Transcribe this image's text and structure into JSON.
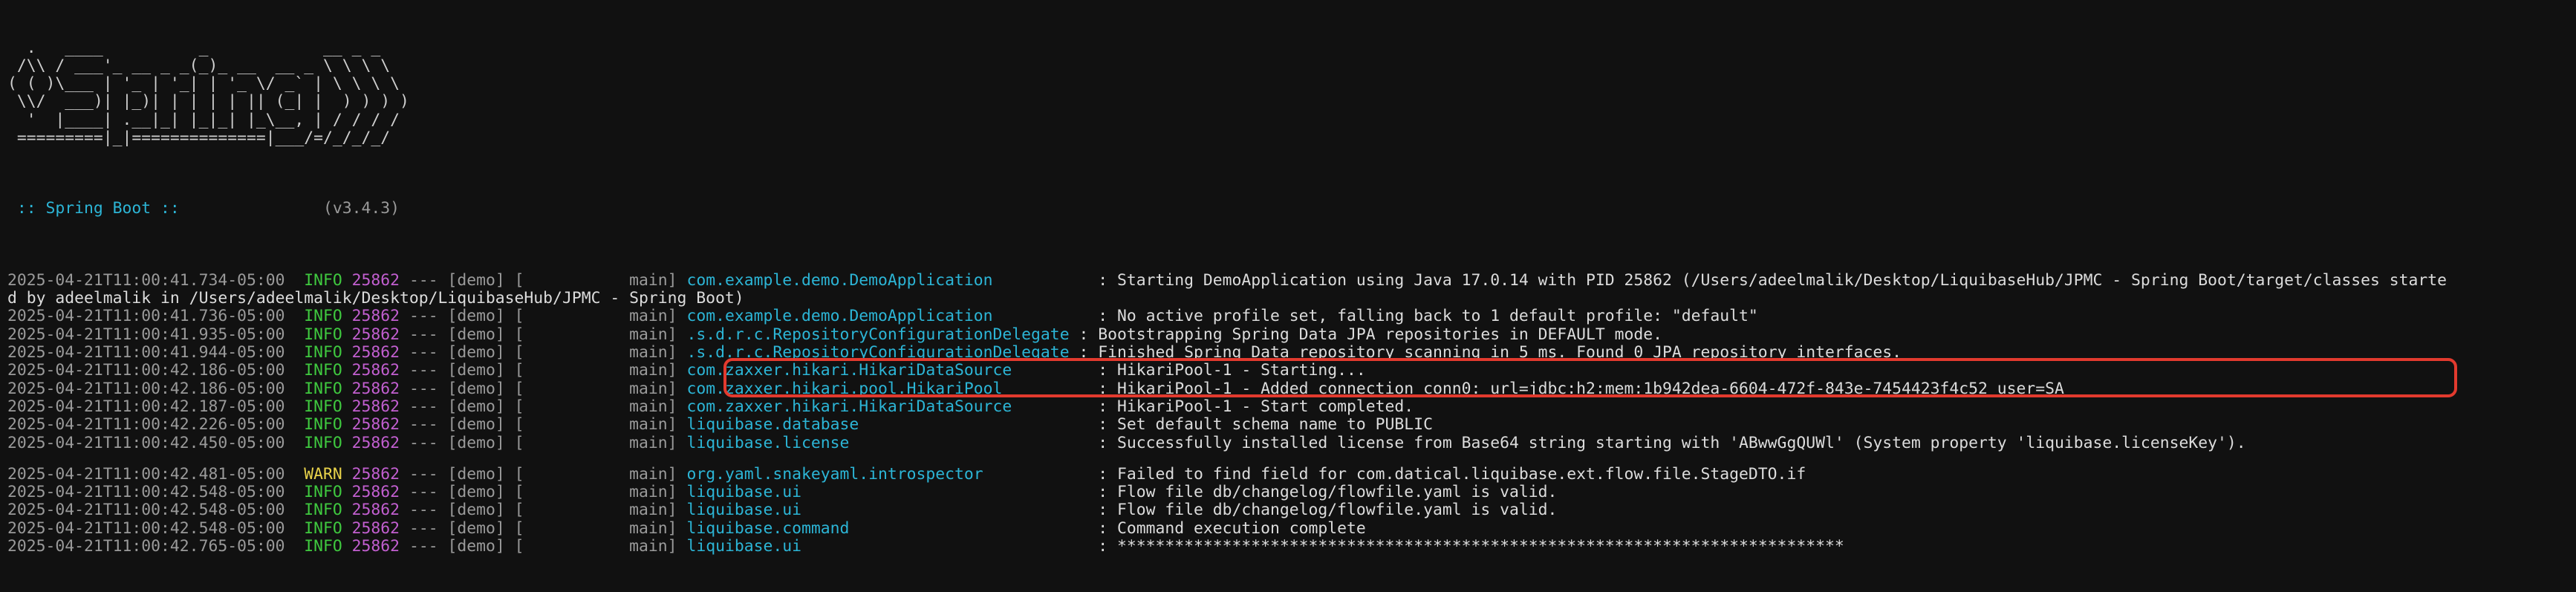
{
  "banner": [
    "  .   ____          _            __ _ _",
    " /\\\\ / ___'_ __ _ _(_)_ __  __ _ \\ \\ \\ \\",
    "( ( )\\___ | '_ | '_| | '_ \\/ _` | \\ \\ \\ \\",
    " \\\\/  ___)| |_)| | | | | || (_| |  ) ) ) )",
    "  '  |____| .__|_| |_|_| |_\\__, | / / / /",
    " =========|_|==============|___/=/_/_/_/"
  ],
  "boot": {
    "name": " :: Spring Boot :: ",
    "version": "              (v3.4.3)"
  },
  "logs": [
    {
      "ts": "2025-04-21T11:00:41.734-05:00",
      "level": "INFO",
      "pid": "25862",
      "sep": " --- ",
      "app": "[demo] [",
      "thread": "           main] ",
      "logger": "com.example.demo.DemoApplication          ",
      "msg": " : Starting DemoApplication using Java 17.0.14 with PID 25862 (/Users/adeelmalik/Desktop/LiquibaseHub/JPMC - Spring Boot/target/classes starte"
    },
    {
      "wrap": "d by adeelmalik in /Users/adeelmalik/Desktop/LiquibaseHub/JPMC - Spring Boot)"
    },
    {
      "ts": "2025-04-21T11:00:41.736-05:00",
      "level": "INFO",
      "pid": "25862",
      "sep": " --- ",
      "app": "[demo] [",
      "thread": "           main] ",
      "logger": "com.example.demo.DemoApplication          ",
      "msg": " : No active profile set, falling back to 1 default profile: \"default\""
    },
    {
      "ts": "2025-04-21T11:00:41.935-05:00",
      "level": "INFO",
      "pid": "25862",
      "sep": " --- ",
      "app": "[demo] [",
      "thread": "           main] ",
      "logger": ".s.d.r.c.RepositoryConfigurationDelegate",
      "msg": " : Bootstrapping Spring Data JPA repositories in DEFAULT mode."
    },
    {
      "ts": "2025-04-21T11:00:41.944-05:00",
      "level": "INFO",
      "pid": "25862",
      "sep": " --- ",
      "app": "[demo] [",
      "thread": "           main] ",
      "logger": ".s.d.r.c.RepositoryConfigurationDelegate",
      "msg": " : Finished Spring Data repository scanning in 5 ms. Found 0 JPA repository interfaces."
    },
    {
      "ts": "2025-04-21T11:00:42.186-05:00",
      "level": "INFO",
      "pid": "25862",
      "sep": " --- ",
      "app": "[demo] [",
      "thread": "           main] ",
      "logger": "com.zaxxer.hikari.HikariDataSource        ",
      "msg": " : HikariPool-1 - Starting..."
    },
    {
      "ts": "2025-04-21T11:00:42.186-05:00",
      "level": "INFO",
      "pid": "25862",
      "sep": " --- ",
      "app": "[demo] [",
      "thread": "           main] ",
      "logger": "com.zaxxer.hikari.pool.HikariPool         ",
      "msg": " : HikariPool-1 - Added connection conn0: url=jdbc:h2:mem:1b942dea-6604-472f-843e-7454423f4c52 user=SA"
    },
    {
      "ts": "2025-04-21T11:00:42.187-05:00",
      "level": "INFO",
      "pid": "25862",
      "sep": " --- ",
      "app": "[demo] [",
      "thread": "           main] ",
      "logger": "com.zaxxer.hikari.HikariDataSource        ",
      "msg": " : HikariPool-1 - Start completed."
    },
    {
      "ts": "2025-04-21T11:00:42.226-05:00",
      "level": "INFO",
      "pid": "25862",
      "sep": " --- ",
      "app": "[demo] [",
      "thread": "           main] ",
      "logger": "liquibase.database                        ",
      "msg": " : Set default schema name to PUBLIC"
    },
    {
      "ts": "2025-04-21T11:00:42.450-05:00",
      "level": "INFO",
      "pid": "25862",
      "sep": " --- ",
      "app": "[demo] [",
      "thread": "           main] ",
      "logger": "liquibase.license                         ",
      "msg": " : Successfully installed license from Base64 string starting with 'ABwwGgQUWl' (System property 'liquibase.licenseKey')."
    },
    {
      "gap": true
    },
    {
      "ts": "2025-04-21T11:00:42.481-05:00",
      "level": "WARN",
      "pid": "25862",
      "sep": " --- ",
      "app": "[demo] [",
      "thread": "           main] ",
      "logger": "org.yaml.snakeyaml.introspector           ",
      "msg": " : Failed to find field for com.datical.liquibase.ext.flow.file.StageDTO.if"
    },
    {
      "ts": "2025-04-21T11:00:42.548-05:00",
      "level": "INFO",
      "pid": "25862",
      "sep": " --- ",
      "app": "[demo] [",
      "thread": "           main] ",
      "logger": "liquibase.ui                              ",
      "msg": " : Flow file db/changelog/flowfile.yaml is valid."
    },
    {
      "ts": "2025-04-21T11:00:42.548-05:00",
      "level": "INFO",
      "pid": "25862",
      "sep": " --- ",
      "app": "[demo] [",
      "thread": "           main] ",
      "logger": "liquibase.ui                              ",
      "msg": " : Flow file db/changelog/flowfile.yaml is valid."
    },
    {
      "ts": "2025-04-21T11:00:42.548-05:00",
      "level": "INFO",
      "pid": "25862",
      "sep": " --- ",
      "app": "[demo] [",
      "thread": "           main] ",
      "logger": "liquibase.command                         ",
      "msg": " : Command execution complete"
    },
    {
      "ts": "2025-04-21T11:00:42.765-05:00",
      "level": "INFO",
      "pid": "25862",
      "sep": " --- ",
      "app": "[demo] [",
      "thread": "           main] ",
      "logger": "liquibase.ui                              ",
      "msg": " : ****************************************************************************"
    }
  ],
  "colors": {
    "info": "#3fc93f",
    "warn": "#e8d24a",
    "pid": "#c25fd0",
    "logger": "#2cb5d6",
    "highlight": "#e23a2e"
  }
}
